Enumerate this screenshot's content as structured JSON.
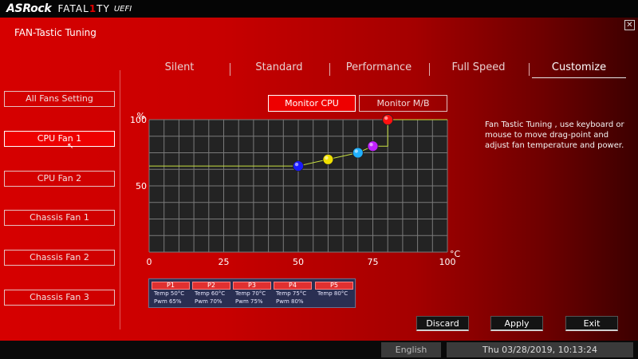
{
  "brand": {
    "asrock": "ASRock",
    "fatality_pre": "FATAL",
    "fatality_one": "1",
    "fatality_post": "TY",
    "uefi": "UEFI"
  },
  "page_title": "FAN-Tastic Tuning",
  "close_icon": "close-icon",
  "tabs": [
    {
      "label": "Silent"
    },
    {
      "label": "Standard"
    },
    {
      "label": "Performance"
    },
    {
      "label": "Full Speed"
    },
    {
      "label": "Customize",
      "active": true
    }
  ],
  "sidebar": {
    "items": [
      {
        "label": "All Fans Setting"
      },
      {
        "label": "CPU Fan 1",
        "active": true
      },
      {
        "label": "CPU Fan 2"
      },
      {
        "label": "Chassis Fan 1"
      },
      {
        "label": "Chassis Fan 2"
      },
      {
        "label": "Chassis Fan 3"
      }
    ]
  },
  "monitor": {
    "cpu_label": "Monitor CPU",
    "mb_label": "Monitor M/B",
    "selected": "Monitor CPU"
  },
  "chart_data": {
    "type": "line",
    "y_unit": "%",
    "x_unit": "°C",
    "x_ticks": [
      "0",
      "25",
      "50",
      "75",
      "100"
    ],
    "y_ticks": [
      "50",
      "100"
    ],
    "xlim": [
      0,
      100
    ],
    "ylim": [
      0,
      100
    ],
    "grid": true,
    "baseline_pwm": 65,
    "points": [
      {
        "name": "P1",
        "x": 50,
        "y": 65,
        "color": "#1a1aff"
      },
      {
        "name": "P2",
        "x": 60,
        "y": 70,
        "color": "#f0e000"
      },
      {
        "name": "P3",
        "x": 70,
        "y": 75,
        "color": "#20b0ff"
      },
      {
        "name": "P4",
        "x": 75,
        "y": 80,
        "color": "#c020ff"
      },
      {
        "name": "P5",
        "x": 80,
        "y": 100,
        "color": "#ff1010"
      }
    ],
    "line_color": "#c8e040"
  },
  "help_text": "Fan Tastic Tuning , use keyboard or mouse to move drag-point and adjust fan temperature and power.",
  "point_table": [
    {
      "name": "P1",
      "temp": "Temp 50°C",
      "pwm": "Pwm  65%"
    },
    {
      "name": "P2",
      "temp": "Temp 60°C",
      "pwm": "Pwm  70%"
    },
    {
      "name": "P3",
      "temp": "Temp 70°C",
      "pwm": "Pwm  75%"
    },
    {
      "name": "P4",
      "temp": "Temp 75°C",
      "pwm": "Pwm  80%"
    },
    {
      "name": "P5",
      "temp": "Temp 80°C",
      "pwm": ""
    }
  ],
  "actions": {
    "discard": "Discard",
    "apply": "Apply",
    "exit": "Exit"
  },
  "footer": {
    "language": "English",
    "datetime": "Thu 03/28/2019, 10:13:24"
  }
}
